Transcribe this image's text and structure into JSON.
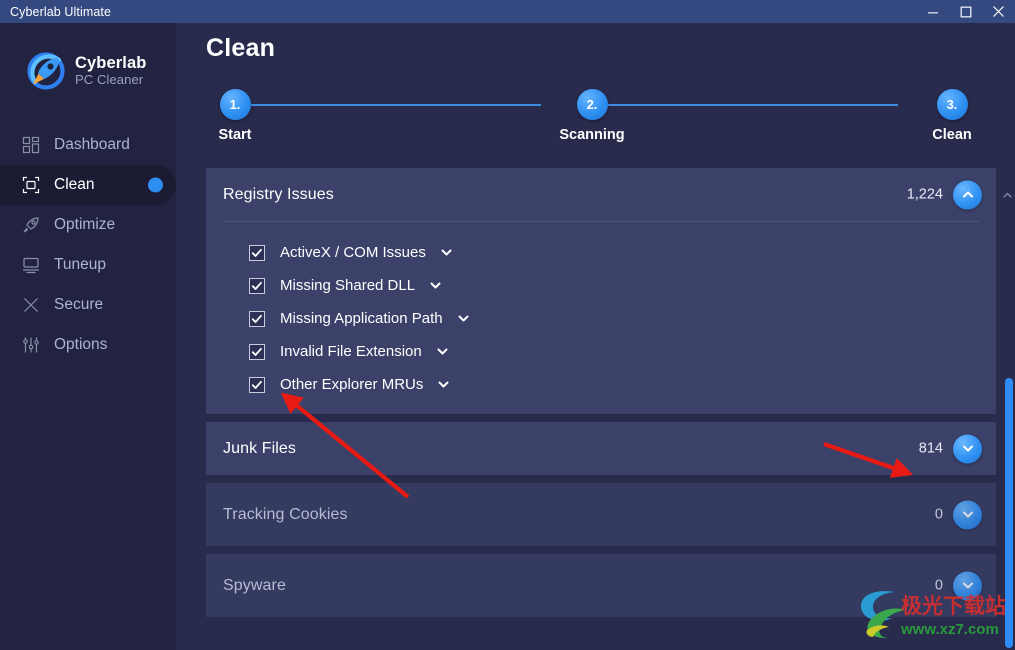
{
  "window": {
    "title": "Cyberlab Ultimate",
    "controls": [
      {
        "name": "minimize",
        "glyph": "minimize-icon"
      },
      {
        "name": "maximize",
        "glyph": "maximize-icon"
      },
      {
        "name": "close",
        "glyph": "close-icon"
      }
    ]
  },
  "brand": {
    "logo_icon": "rocket-logo-icon",
    "name": "Cyberlab",
    "tagline": "PC Cleaner"
  },
  "sidebar": {
    "items": [
      {
        "label": "Dashboard",
        "icon": "dashboard-icon",
        "active": false
      },
      {
        "label": "Clean",
        "icon": "clean-icon",
        "active": true
      },
      {
        "label": "Optimize",
        "icon": "rocket-icon",
        "active": false
      },
      {
        "label": "Tuneup",
        "icon": "tuneup-icon",
        "active": false
      },
      {
        "label": "Secure",
        "icon": "shield-tools-icon",
        "active": false
      },
      {
        "label": "Options",
        "icon": "sliders-icon",
        "active": false
      }
    ]
  },
  "page": {
    "title": "Clean"
  },
  "stepper": {
    "steps": [
      {
        "number": "1.",
        "label": "Start"
      },
      {
        "number": "2.",
        "label": "Scanning"
      },
      {
        "number": "3.",
        "label": "Clean"
      }
    ]
  },
  "categories": [
    {
      "title": "Registry Issues",
      "count": "1,224",
      "expanded": true,
      "toggle_icon": "chevron-up-icon",
      "items": [
        {
          "label": "ActiveX / COM Issues",
          "checked": true,
          "chevron": "chevron-down-icon"
        },
        {
          "label": "Missing Shared DLL",
          "checked": true,
          "chevron": "chevron-down-icon"
        },
        {
          "label": "Missing Application Path",
          "checked": true,
          "chevron": "chevron-down-icon"
        },
        {
          "label": "Invalid File Extension",
          "checked": true,
          "chevron": "chevron-down-icon"
        },
        {
          "label": "Other Explorer MRUs",
          "checked": true,
          "chevron": "chevron-down-icon"
        }
      ]
    },
    {
      "title": "Junk Files",
      "count": "814",
      "expanded": false,
      "toggle_icon": "chevron-down-icon",
      "items": []
    },
    {
      "title": "Tracking Cookies",
      "count": "0",
      "expanded": false,
      "toggle_icon": "chevron-down-icon",
      "items": []
    },
    {
      "title": "Spyware",
      "count": "0",
      "expanded": false,
      "toggle_icon": "chevron-down-icon",
      "items": []
    }
  ],
  "watermark": {
    "text_cn": "极光下载站",
    "url": "www.xz7.com"
  },
  "colors": {
    "accent": "#2e90f2",
    "sidebar_bg": "#212340",
    "main_bg": "#282b4c",
    "panel_bg": "#3b4169",
    "titlebar_bg": "#34497f",
    "annotation_red": "#e81b14"
  }
}
